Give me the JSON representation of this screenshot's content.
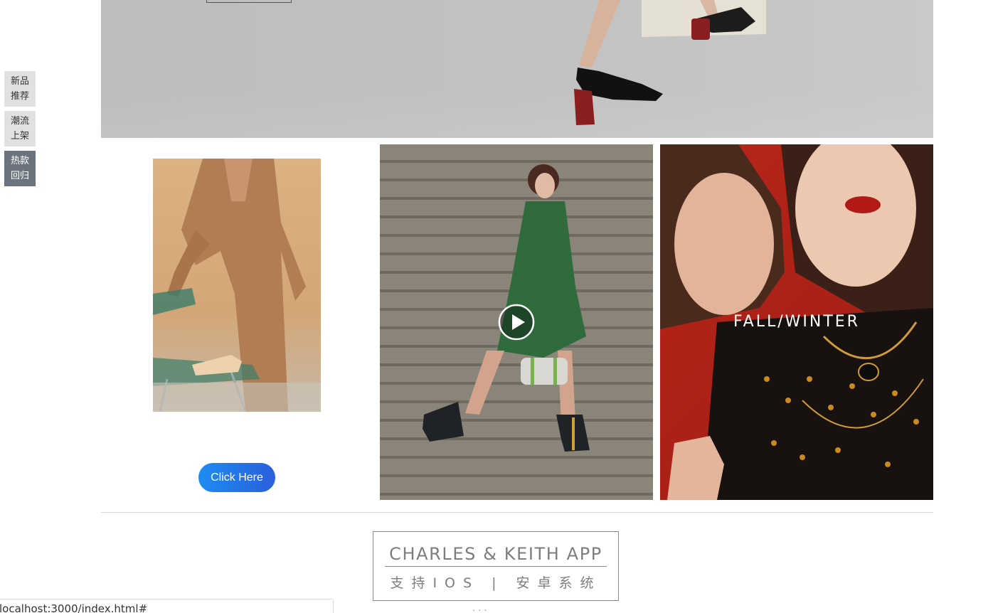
{
  "side_nav": {
    "items": [
      {
        "label": "新品推荐"
      },
      {
        "label": "潮流上架"
      },
      {
        "label": "热款回归"
      }
    ],
    "active_index": 2
  },
  "product_row": {
    "cta_label": "Click Here",
    "campaign_caption": "FALL/WINTER"
  },
  "app_promo": {
    "title": "CHARLES & KEITH APP",
    "subtitle": "支持IOS  |  安卓系统"
  },
  "below_fold_text": "· · ·",
  "status_url": "localhost:3000/index.html#",
  "icons": {
    "play": "play-icon"
  },
  "colors": {
    "cta_start": "#1d8cf0",
    "cta_end": "#2a5fdc",
    "active_nav": "#6b747e",
    "campaign_bg": "#b8251a"
  }
}
